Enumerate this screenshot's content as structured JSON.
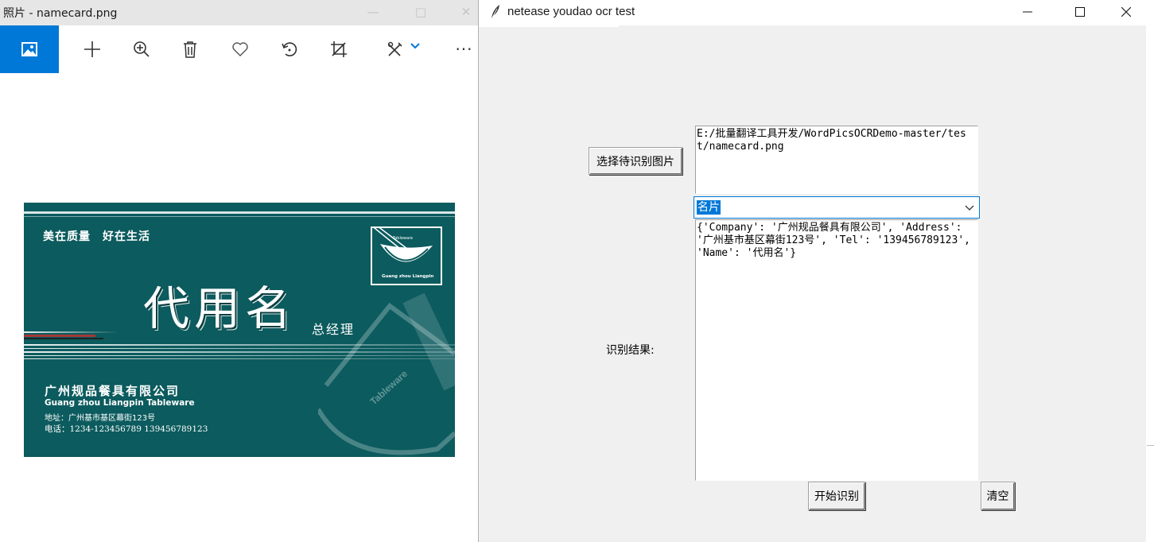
{
  "photos_window": {
    "title": "照片 - namecard.png",
    "toolbar": {
      "items": [
        "image-view",
        "add",
        "zoom",
        "delete",
        "favorite",
        "rotate",
        "crop",
        "edit",
        "more"
      ],
      "more_label": "···"
    }
  },
  "namecard": {
    "slogan": "美在质量　好在生活",
    "name": "代用名",
    "role": "总经理",
    "company_cn": "广州规品餐具有限公司",
    "company_en": "Guang zhou Liangpin Tableware",
    "address": "地址：广州基市基区幕街123号",
    "phone": "电话：1234-123456789  139456789123",
    "logo_text_top": "Tableware",
    "logo_text_bottom": "Guang zhou Liangpin",
    "watermark": "Tableware",
    "colors": {
      "background": "#0c5b5e",
      "text": "#ffffff"
    }
  },
  "tk_window": {
    "title": "netease youdao ocr test",
    "select_button": "选择待识别图片",
    "file_path": "E:/批量翻译工具开发/WordPicsOCRDemo-master/test/namecard.png",
    "type_combo": {
      "selected": "名片"
    },
    "result_label": "识别结果:",
    "result_text": "{'Company': '广州规品餐具有限公司', 'Address': '广州基市基区幕街123号', 'Tel': '139456789123', 'Name': '代用名'}",
    "start_button": "开始识别",
    "clear_button": "清空",
    "colors": {
      "window_bg": "#f0f0f0",
      "accent": "#0078d7"
    }
  }
}
